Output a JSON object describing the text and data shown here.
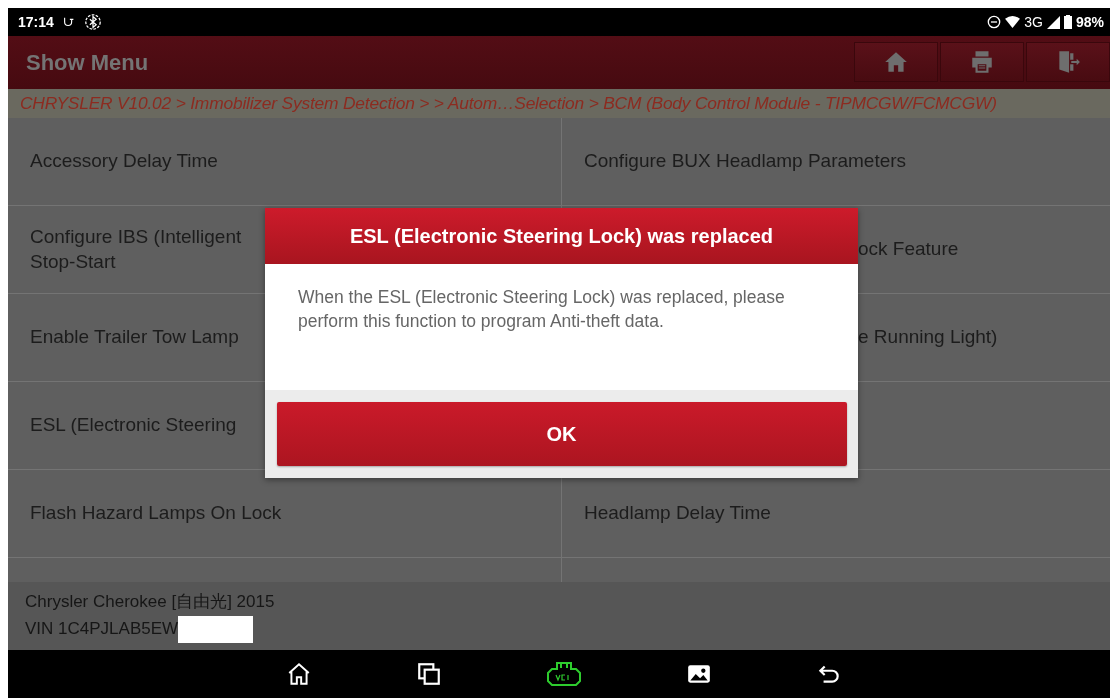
{
  "status_bar": {
    "time": "17:14",
    "network": "3G",
    "battery": "98%"
  },
  "header": {
    "title": "Show Menu",
    "buttons": [
      {
        "kind": "home"
      },
      {
        "kind": "print"
      },
      {
        "kind": "exit"
      }
    ]
  },
  "breadcrumb": "CHRYSLER V10.02 > Immobilizer System Detection >  > Autom…Selection > BCM (Body Control Module - TIPMCGW/FCMCGW)",
  "menu_items": [
    {
      "label": "Accessory Delay Time",
      "kind": "full"
    },
    {
      "label": "Configure BUX Headlamp Parameters",
      "kind": "full"
    },
    {
      "label": "Configure IBS (Intelligent Stop-Start",
      "kind": "full"
    },
    {
      "label": "ock Feature",
      "kind": "partial"
    },
    {
      "label": "Enable Trailer Tow Lamp",
      "kind": "full"
    },
    {
      "label": "e Running Light)",
      "kind": "partial"
    },
    {
      "label": "ESL (Electronic Steering",
      "kind": "full"
    },
    {
      "kind": "empty"
    },
    {
      "label": "Flash Hazard Lamps On Lock",
      "kind": "full"
    },
    {
      "label": "Headlamp Delay Time",
      "kind": "full"
    },
    {
      "kind": "empty"
    },
    {
      "kind": "empty"
    }
  ],
  "vehicle": {
    "name": "Chrysler Cherokee [自由光] 2015",
    "vin": "VIN 1C4PJLAB5EW"
  },
  "dialog": {
    "title": "ESL (Electronic Steering Lock) was replaced",
    "message": "When the ESL (Electronic Steering Lock) was replaced, please perform this function to program Anti-theft data.",
    "button": "OK"
  },
  "nav_bar": [
    {
      "kind": "home"
    },
    {
      "kind": "recents"
    },
    {
      "kind": "vci"
    },
    {
      "kind": "gallery"
    },
    {
      "kind": "back"
    }
  ]
}
